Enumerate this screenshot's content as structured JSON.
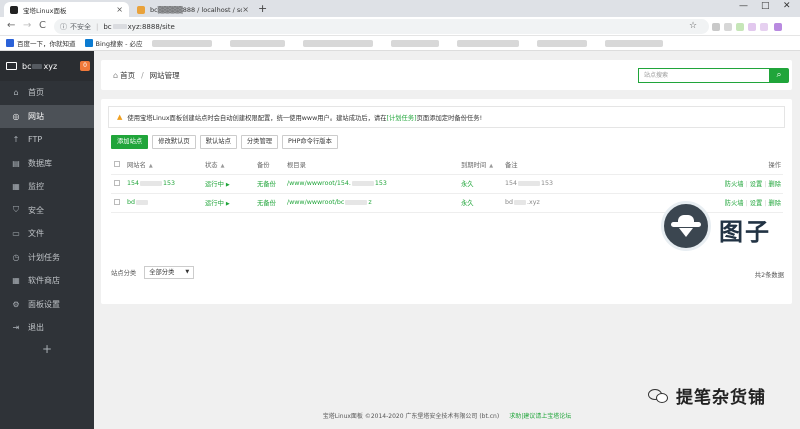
{
  "browser": {
    "tabs": [
      {
        "title": "宝塔Linux面板",
        "close": "×"
      },
      {
        "title": "bc▒▒▒▒▒888 / localhost / sql",
        "close": "×"
      }
    ],
    "new_tab": "+",
    "window_controls": {
      "minimize": "—",
      "maximize": "□",
      "close": "✕"
    },
    "nav": {
      "back": "←",
      "forward": "→",
      "reload": "C"
    },
    "security_text": "不安全",
    "url_host": "bc",
    "url_rest": "xyz:8888/site",
    "bookmark_star": "☆",
    "bookmarks": [
      {
        "label": "百度一下，你就知道",
        "icon": "paw-icon",
        "color": "#2b62d8"
      },
      {
        "label": "Bing搜索 - 必应",
        "icon": "bing-icon",
        "color": "#0b7bd1"
      }
    ]
  },
  "sidebar": {
    "server_name_a": "bc",
    "server_name_b": "xyz",
    "badge": "0",
    "items": [
      {
        "label": "首页",
        "icon": "home-icon",
        "glyph": "⌂"
      },
      {
        "label": "网站",
        "icon": "globe-icon",
        "glyph": "◎"
      },
      {
        "label": "FTP",
        "icon": "upload-icon",
        "glyph": "↑"
      },
      {
        "label": "数据库",
        "icon": "database-icon",
        "glyph": "▤"
      },
      {
        "label": "监控",
        "icon": "monitor-icon",
        "glyph": "▦"
      },
      {
        "label": "安全",
        "icon": "shield-icon",
        "glyph": "⛉"
      },
      {
        "label": "文件",
        "icon": "folder-icon",
        "glyph": "▭"
      },
      {
        "label": "计划任务",
        "icon": "clock-icon",
        "glyph": "◷"
      },
      {
        "label": "软件商店",
        "icon": "grid-icon",
        "glyph": "▦"
      },
      {
        "label": "面板设置",
        "icon": "gear-icon",
        "glyph": "⚙"
      },
      {
        "label": "退出",
        "icon": "logout-icon",
        "glyph": "⇥"
      }
    ],
    "add": "+"
  },
  "header": {
    "breadcrumb_home": "首页",
    "breadcrumb_sep": "/",
    "breadcrumb_current": "网站管理",
    "search_placeholder": "站点搜索"
  },
  "notice": {
    "warn_icon": "▲",
    "text_before": "使用宝塔Linux面板创建站点时会自动创建权限配置，统一使用www用户。建站成功后，请在",
    "link": "[计划任务]",
    "text_after": "页面添加定时备份任务!"
  },
  "toolbar": {
    "add_site": "添加站点",
    "modify_default_page": "修改默认页",
    "default_site": "默认站点",
    "category_manage": "分类管理",
    "php_cli_version": "PHP命令行版本"
  },
  "table": {
    "headers": {
      "name": "网站名",
      "status": "状态",
      "backup": "备份",
      "root": "根目录",
      "expire": "到期时间",
      "remark": "备注",
      "ops": "操作"
    },
    "rows": [
      {
        "name_a": "154",
        "name_b": "153",
        "status": "运行中",
        "backup": "无备份",
        "root_a": "/www/wwwroot/154.",
        "root_b": "153",
        "expire": "永久",
        "remark_a": "154",
        "remark_b": "153",
        "op_firewall": "防火墙",
        "op_settings": "设置",
        "op_delete": "删除"
      },
      {
        "name_a": "bd",
        "name_b": "",
        "status": "运行中",
        "backup": "无备份",
        "root_a": "/www/wwwroot/bc",
        "root_b": "z",
        "expire": "永久",
        "remark_a": "bd",
        "remark_b": ".xyz",
        "op_firewall": "防火墙",
        "op_settings": "设置",
        "op_delete": "删除"
      }
    ],
    "sep": "|",
    "play": "▶"
  },
  "footer": {
    "category_label": "站点分类",
    "category_value": "全部分类",
    "total": "共2条数据"
  },
  "copyright": {
    "text": "宝塔Linux面板 ©2014-2020 广东堡塔安全技术有限公司 (bt.cn)",
    "link": "求助|建议请上宝塔论坛"
  },
  "watermark": {
    "chars": "图子",
    "account": "提笔杂货铺"
  },
  "colors": {
    "accent": "#20a53a",
    "sidebar": "#2f3338",
    "warn": "#f0a020",
    "badge": "#f0793a"
  }
}
